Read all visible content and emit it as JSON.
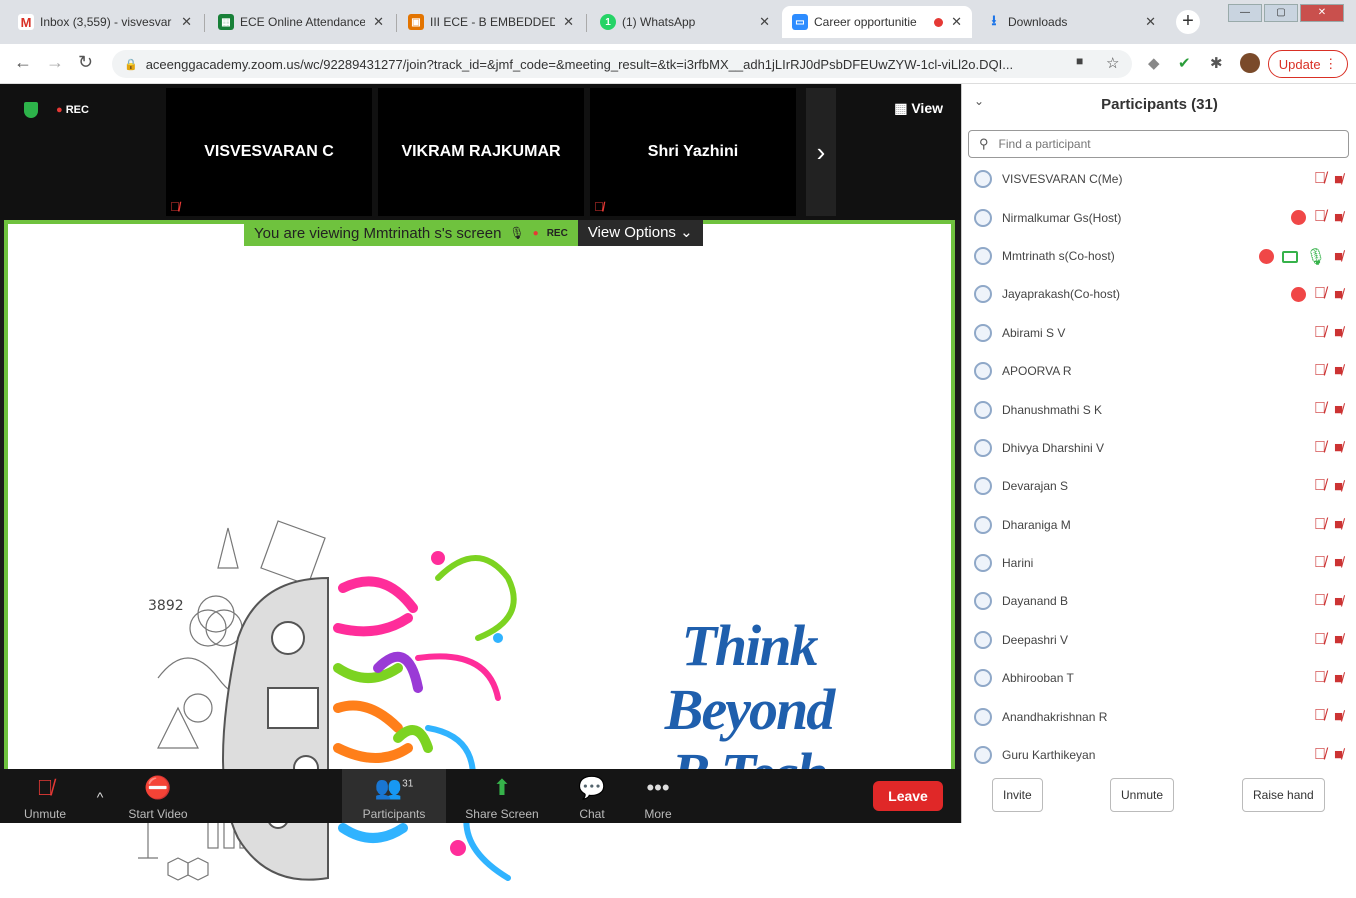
{
  "tabs": [
    {
      "title": "Inbox (3,559) - visvesvar",
      "icon": "gmail-icon",
      "color": "#d93025"
    },
    {
      "title": "ECE Online Attendance",
      "icon": "sheets-icon",
      "color": "#188038"
    },
    {
      "title": "III ECE - B EMBEDDED S",
      "icon": "classroom-icon",
      "color": "#e37400"
    },
    {
      "title": "(1) WhatsApp",
      "icon": "whatsapp-icon",
      "color": "#25d366"
    },
    {
      "title": "Career opportunitie",
      "icon": "zoom-icon",
      "color": "#2d8cff"
    },
    {
      "title": "Downloads",
      "icon": "download-icon",
      "color": "#1a73e8"
    }
  ],
  "address": {
    "url": "aceenggacademy.zoom.us/wc/92289431277/join?track_id=&jmf_code=&meeting_result=&tk=i3rfbMX__adh1jLIrRJ0dPsbDFEUwZYW-1cl-viLl2o.DQI...",
    "update_label": "Update"
  },
  "meeting": {
    "rec_label": "REC",
    "view_label": "View",
    "thumbnails": [
      "VISVESVARAN C",
      "VIKRAM RAJKUMAR",
      "Shri Yazhini"
    ],
    "viewing_text": "You are viewing Mmtrinath s's screen",
    "viewing_rec": "REC",
    "view_options": "View Options",
    "slide_line1": "Think Beyond",
    "slide_line2": "B.Tech",
    "slide_number": "3892"
  },
  "toolbar": {
    "unmute": "Unmute",
    "start_video": "Start Video",
    "participants": "Participants",
    "participants_count": "31",
    "share_screen": "Share Screen",
    "chat": "Chat",
    "more": "More",
    "leave": "Leave"
  },
  "panel": {
    "title": "Participants (31)",
    "search_placeholder": "Find a participant",
    "participants": [
      {
        "name": "VISVESVARAN C(Me)",
        "rec": false,
        "screen": false,
        "mic_on": false
      },
      {
        "name": "Nirmalkumar Gs(Host)",
        "rec": true,
        "screen": false,
        "mic_on": false
      },
      {
        "name": "Mmtrinath s(Co-host)",
        "rec": true,
        "screen": true,
        "mic_on": true
      },
      {
        "name": "Jayaprakash(Co-host)",
        "rec": true,
        "screen": false,
        "mic_on": false
      },
      {
        "name": "Abirami S V",
        "rec": false,
        "screen": false,
        "mic_on": false
      },
      {
        "name": "APOORVA R",
        "rec": false,
        "screen": false,
        "mic_on": false
      },
      {
        "name": "Dhanushmathi S K",
        "rec": false,
        "screen": false,
        "mic_on": false
      },
      {
        "name": "Dhivya Dharshini V",
        "rec": false,
        "screen": false,
        "mic_on": false
      },
      {
        "name": "Devarajan S",
        "rec": false,
        "screen": false,
        "mic_on": false
      },
      {
        "name": "Dharaniga M",
        "rec": false,
        "screen": false,
        "mic_on": false
      },
      {
        "name": "Harini",
        "rec": false,
        "screen": false,
        "mic_on": false
      },
      {
        "name": "Dayanand B",
        "rec": false,
        "screen": false,
        "mic_on": false
      },
      {
        "name": "Deepashri V",
        "rec": false,
        "screen": false,
        "mic_on": false
      },
      {
        "name": "Abhirooban T",
        "rec": false,
        "screen": false,
        "mic_on": false
      },
      {
        "name": "Anandhakrishnan R",
        "rec": false,
        "screen": false,
        "mic_on": false
      },
      {
        "name": "Guru Karthikeyan",
        "rec": false,
        "screen": false,
        "mic_on": false
      }
    ],
    "invite": "Invite",
    "unmute": "Unmute",
    "raise_hand": "Raise hand"
  }
}
